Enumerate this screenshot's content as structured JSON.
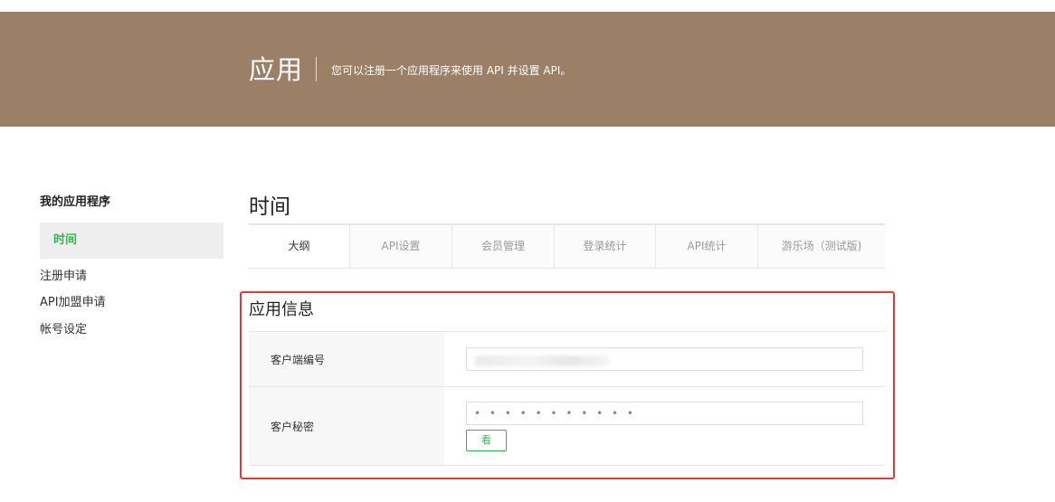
{
  "banner": {
    "title": "应用",
    "description": "您可以注册一个应用程序来使用 API 并设置 API。"
  },
  "sidebar": {
    "heading": "我的应用程序",
    "active_item": "时间",
    "items": [
      {
        "label": "注册申请"
      },
      {
        "label": "API加盟申请"
      },
      {
        "label": "帐号设定"
      }
    ]
  },
  "main": {
    "title": "时间",
    "tabs": [
      {
        "label": "大纲",
        "active": true
      },
      {
        "label": "API设置",
        "active": false
      },
      {
        "label": "会员管理",
        "active": false
      },
      {
        "label": "登录统计",
        "active": false
      },
      {
        "label": "API统计",
        "active": false
      },
      {
        "label": "游乐场（测试版)",
        "active": false
      }
    ],
    "info": {
      "title": "应用信息",
      "client_id_label": "客户端编号",
      "client_secret_label": "客户秘密",
      "client_secret_value": "• • • • • • • • • • •",
      "show_button": "看"
    }
  },
  "colors": {
    "banner_bg": "#9b7f66",
    "accent_green": "#2db84d",
    "highlight_red": "#e53935"
  }
}
